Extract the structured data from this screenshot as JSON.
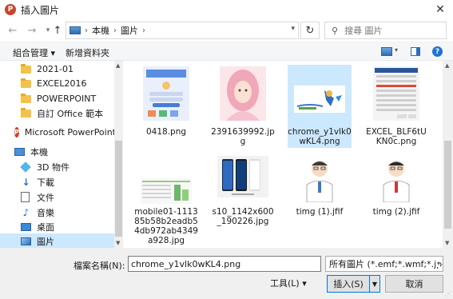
{
  "window": {
    "title": "插入圖片",
    "close_glyph": "✕"
  },
  "address": {
    "crumbs": [
      "本機",
      "圖片"
    ],
    "separator": "›"
  },
  "search": {
    "placeholder": "搜尋 圖片"
  },
  "toolbar": {
    "organize_label": "組合管理 ▾",
    "new_folder_label": "新增資料夾",
    "help_glyph": "?"
  },
  "sidebar": {
    "items": [
      {
        "label": "2021-01"
      },
      {
        "label": "EXCEL2016"
      },
      {
        "label": "POWERPOINT"
      },
      {
        "label": "自訂 Office 範本"
      },
      {
        "label": "Microsoft PowerPoint"
      },
      {
        "label": "本機"
      },
      {
        "label": "3D 物件"
      },
      {
        "label": "下載"
      },
      {
        "label": "文件"
      },
      {
        "label": "音樂"
      },
      {
        "label": "桌面"
      },
      {
        "label": "圖片"
      }
    ]
  },
  "files": [
    {
      "name": "0418.png"
    },
    {
      "name": "2391639992.jpg"
    },
    {
      "name": "chrome_y1vlk0wKL4.png"
    },
    {
      "name": "EXCEL_BLF6tUKN0c.png"
    },
    {
      "name": "mobile01-111385b58b2eadb54db972ab4349a928.jpg"
    },
    {
      "name": "s10_1142x600_190226.jpg"
    },
    {
      "name": "timg (1).jfif"
    },
    {
      "name": "timg (2).jfif"
    }
  ],
  "footer": {
    "filename_label": "檔案名稱(N):",
    "filename_value": "chrome_y1vlk0wKL4.png",
    "filetype_value": "所有圖片 (*.emf;*.wmf;*.jpg;*.jp",
    "tools_label": "工具(L) ▾",
    "insert_label": "插入(S)",
    "cancel_label": "取消"
  },
  "colors": {
    "selection": "#cce8ff",
    "accent": "#0078d7",
    "app_icon": "#c8452c"
  }
}
